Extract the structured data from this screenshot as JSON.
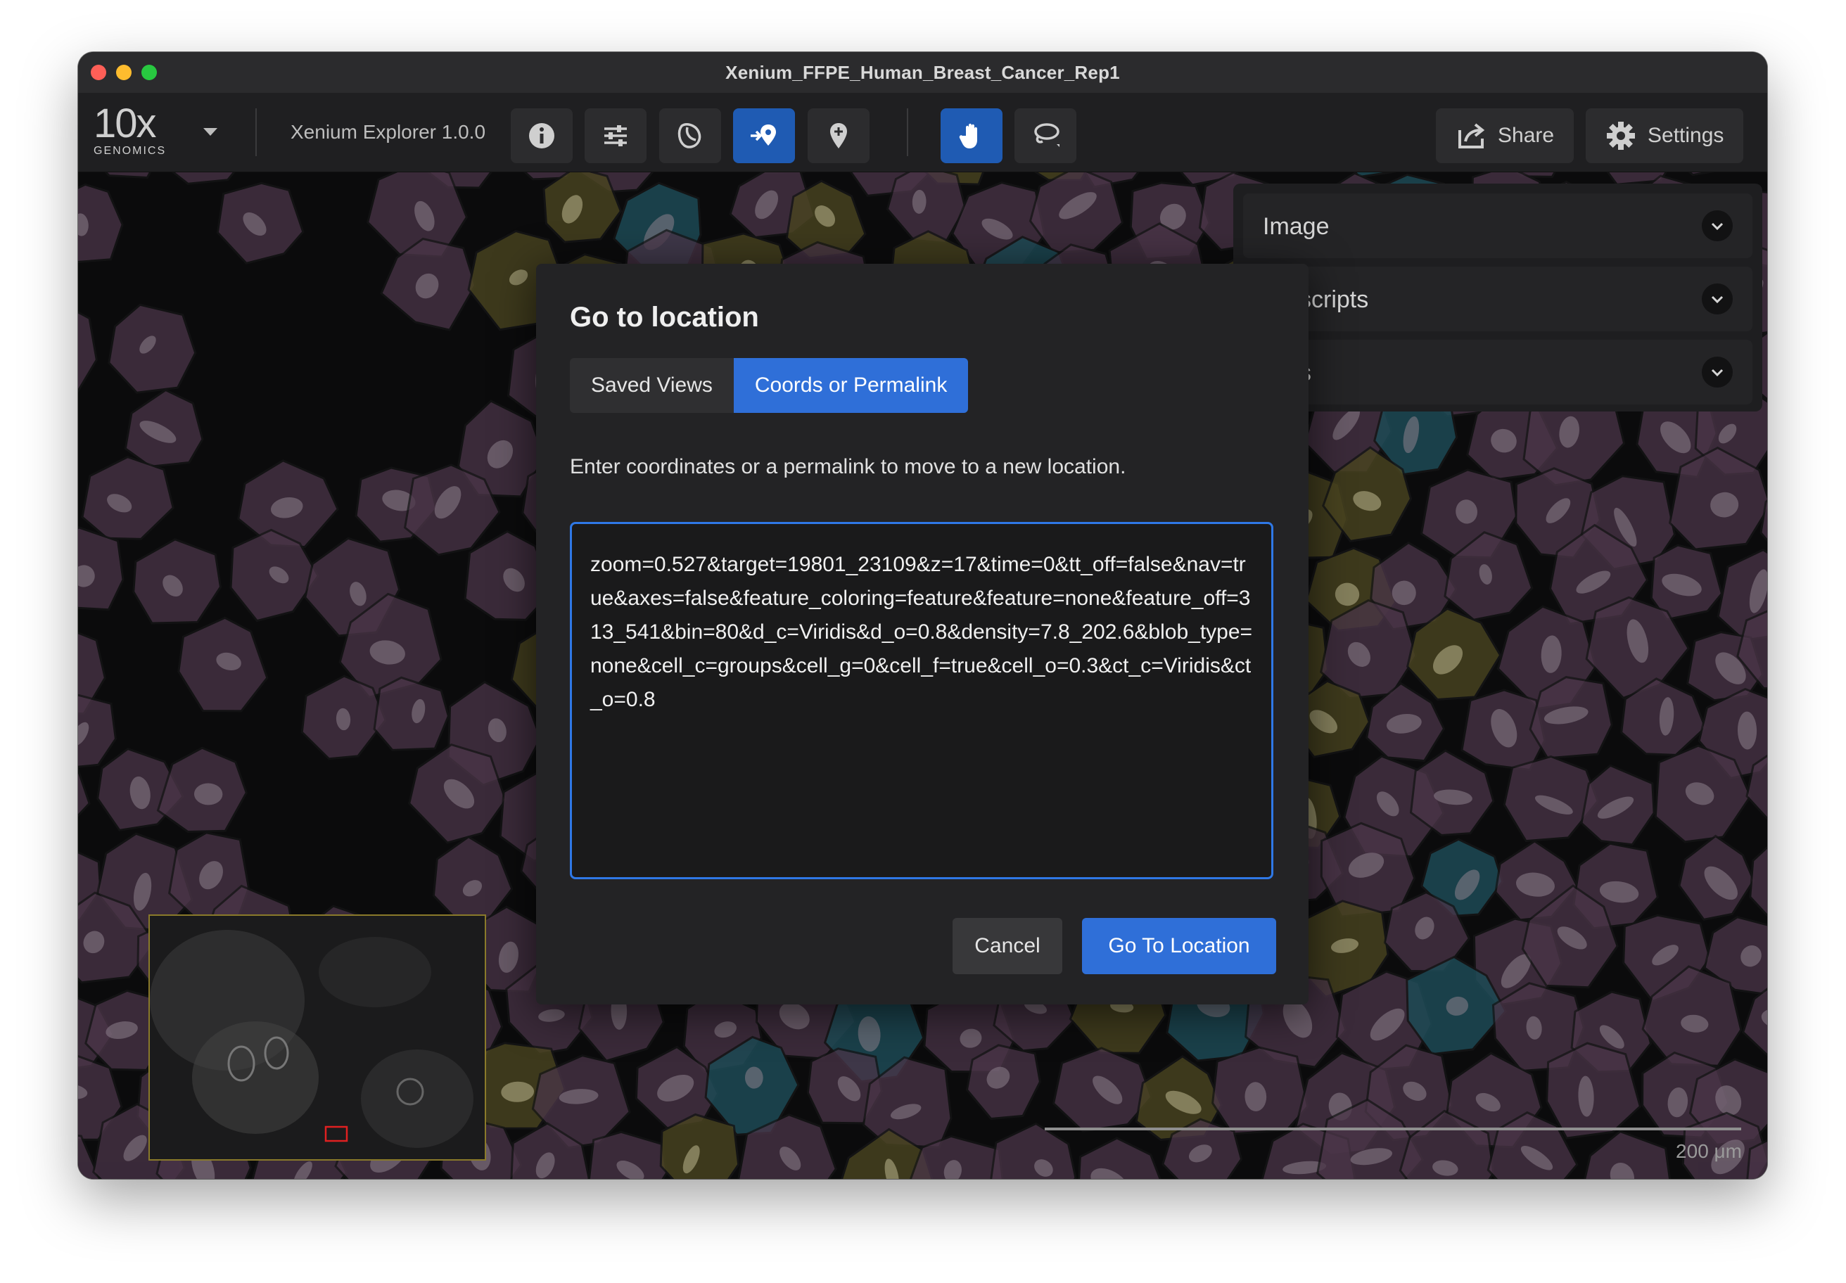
{
  "window": {
    "title": "Xenium_FFPE_Human_Breast_Cancer_Rep1"
  },
  "toolbar": {
    "logo_main": "10x",
    "logo_sub": "GENOMICS",
    "app_name": "Xenium Explorer 1.0.0",
    "share_label": "Share",
    "settings_label": "Settings",
    "icons": [
      "info-icon",
      "sliders-icon",
      "cell-segmentation-icon",
      "go-to-location-icon",
      "pin-icon",
      "hand-pan-icon",
      "lasso-icon"
    ]
  },
  "right_panel": {
    "items": [
      {
        "label": "Image"
      },
      {
        "label": "scripts"
      },
      {
        "label": "s"
      }
    ]
  },
  "scale_bar": {
    "label": "200 μm"
  },
  "dialog": {
    "title": "Go to location",
    "tabs": [
      {
        "label": "Saved Views",
        "active": false
      },
      {
        "label": "Coords or Permalink",
        "active": true
      }
    ],
    "description": "Enter coordinates or a permalink to move to a new location.",
    "permalink_value": "zoom=0.527&target=19801_23109&z=17&time=0&tt_off=false&nav=true&axes=false&feature_coloring=feature&feature=none&feature_off=313_541&bin=80&d_c=Viridis&d_o=0.8&density=7.8_202.6&blob_type=none&cell_c=groups&cell_g=0&cell_f=true&cell_o=0.3&ct_c=Viridis&ct_o=0.8",
    "cancel_label": "Cancel",
    "go_label": "Go To Location"
  },
  "colors": {
    "accent": "#2f6fd8",
    "toolbar_active": "#1f5bb3",
    "cell_purple": "#4a3548",
    "cell_olive": "#4a4520",
    "cell_teal": "#1d4a55"
  }
}
